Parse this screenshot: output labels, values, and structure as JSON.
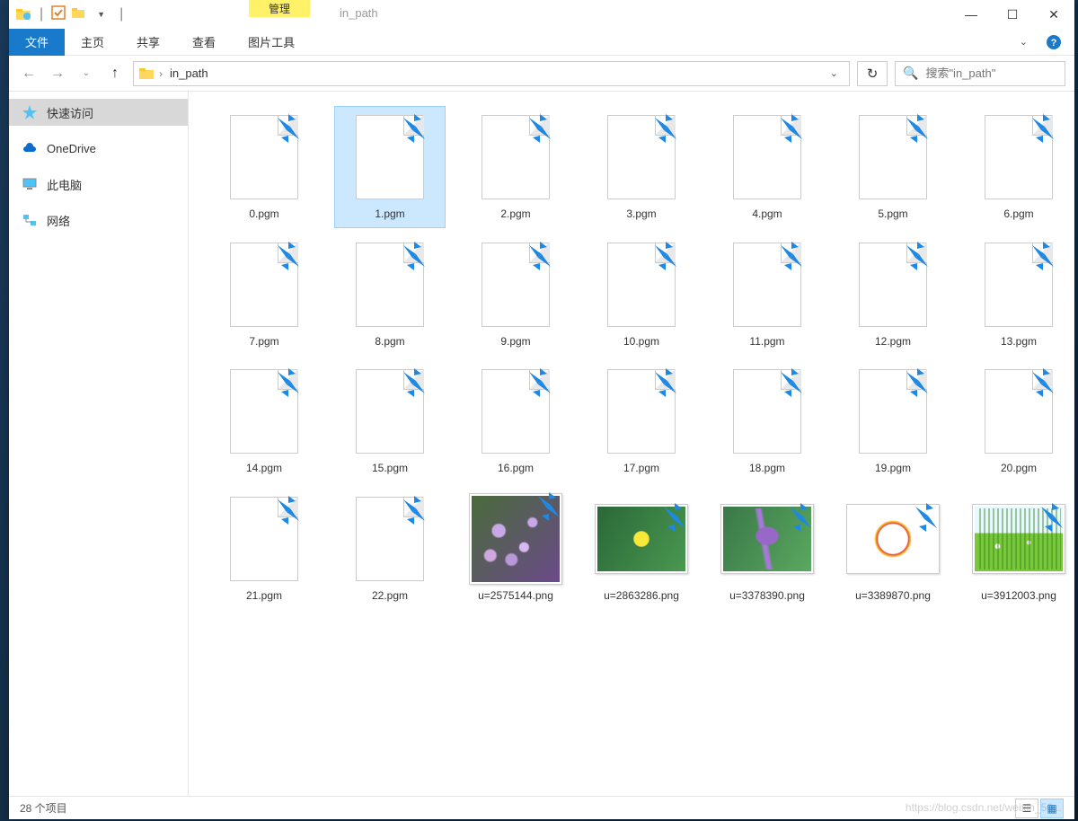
{
  "window": {
    "title": "in_path",
    "manage_label": "管理",
    "ribbon_under_manage": "图片工具"
  },
  "ribbon": {
    "file": "文件",
    "tabs": [
      "主页",
      "共享",
      "查看"
    ]
  },
  "address": {
    "folder": "in_path",
    "search_placeholder": "搜索\"in_path\""
  },
  "sidebar": {
    "items": [
      {
        "label": "快速访问",
        "icon": "star",
        "selected": true
      },
      {
        "label": "OneDrive",
        "icon": "cloud",
        "selected": false
      },
      {
        "label": "此电脑",
        "icon": "pc",
        "selected": false
      },
      {
        "label": "网络",
        "icon": "network",
        "selected": false
      }
    ]
  },
  "files": [
    {
      "name": "0.pgm",
      "type": "pgm",
      "selected": false
    },
    {
      "name": "1.pgm",
      "type": "pgm",
      "selected": true
    },
    {
      "name": "2.pgm",
      "type": "pgm",
      "selected": false
    },
    {
      "name": "3.pgm",
      "type": "pgm",
      "selected": false
    },
    {
      "name": "4.pgm",
      "type": "pgm",
      "selected": false
    },
    {
      "name": "5.pgm",
      "type": "pgm",
      "selected": false
    },
    {
      "name": "6.pgm",
      "type": "pgm",
      "selected": false
    },
    {
      "name": "7.pgm",
      "type": "pgm",
      "selected": false
    },
    {
      "name": "8.pgm",
      "type": "pgm",
      "selected": false
    },
    {
      "name": "9.pgm",
      "type": "pgm",
      "selected": false
    },
    {
      "name": "10.pgm",
      "type": "pgm",
      "selected": false
    },
    {
      "name": "11.pgm",
      "type": "pgm",
      "selected": false
    },
    {
      "name": "12.pgm",
      "type": "pgm",
      "selected": false
    },
    {
      "name": "13.pgm",
      "type": "pgm",
      "selected": false
    },
    {
      "name": "14.pgm",
      "type": "pgm",
      "selected": false
    },
    {
      "name": "15.pgm",
      "type": "pgm",
      "selected": false
    },
    {
      "name": "16.pgm",
      "type": "pgm",
      "selected": false
    },
    {
      "name": "17.pgm",
      "type": "pgm",
      "selected": false
    },
    {
      "name": "18.pgm",
      "type": "pgm",
      "selected": false
    },
    {
      "name": "19.pgm",
      "type": "pgm",
      "selected": false
    },
    {
      "name": "20.pgm",
      "type": "pgm",
      "selected": false
    },
    {
      "name": "21.pgm",
      "type": "pgm",
      "selected": false
    },
    {
      "name": "22.pgm",
      "type": "pgm",
      "selected": false
    },
    {
      "name": "u=2575144.png",
      "type": "img",
      "variant": "flower1",
      "tall": true
    },
    {
      "name": "u=2863286.png",
      "type": "img",
      "variant": "flower2"
    },
    {
      "name": "u=3378390.png",
      "type": "img",
      "variant": "flower3"
    },
    {
      "name": "u=3389870.png",
      "type": "img",
      "variant": "flower4"
    },
    {
      "name": "u=3912003.png",
      "type": "img",
      "variant": "flower5"
    }
  ],
  "status": {
    "count_label": "28 个项目"
  },
  "watermark": "https://blog.csdn.net/weixin_50..."
}
